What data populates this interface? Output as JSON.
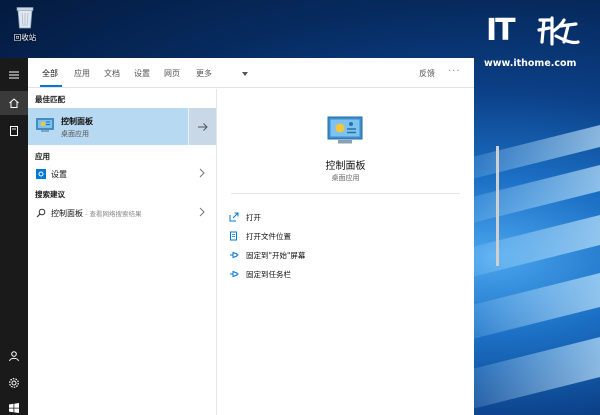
{
  "desktop": {
    "recycle_bin_label": "回收站",
    "watermark_logo_text": "IT之家",
    "site_url": "www.ithome.com"
  },
  "rail": {
    "icons": [
      "hamburger-icon",
      "home-icon",
      "notebook-icon",
      "user-icon",
      "gear-icon",
      "windows-icon"
    ]
  },
  "tabs": {
    "items": [
      {
        "label": "全部"
      },
      {
        "label": "应用"
      },
      {
        "label": "文档"
      },
      {
        "label": "设置"
      },
      {
        "label": "网页"
      },
      {
        "label": "更多"
      }
    ],
    "selected": "全部",
    "feedback": "反馈",
    "more_options": "···"
  },
  "results": {
    "best_match_header": "最佳匹配",
    "best_match": {
      "title": "控制面板",
      "subtitle": "桌面应用"
    },
    "apps_header": "应用",
    "apps": [
      {
        "label": "设置"
      }
    ],
    "suggestions_header": "搜索建议",
    "suggestions": [
      {
        "label": "控制面板",
        "hint": " - 查看网络搜索结果"
      }
    ]
  },
  "detail": {
    "title": "控制面板",
    "subtitle": "桌面应用",
    "actions": [
      {
        "label": "打开",
        "icon": "open-icon"
      },
      {
        "label": "打开文件位置",
        "icon": "file-location-icon"
      },
      {
        "label": "固定到\"开始\"屏幕",
        "icon": "pin-icon"
      },
      {
        "label": "固定到任务栏",
        "icon": "pin-icon"
      }
    ]
  },
  "colors": {
    "accent": "#0078d7",
    "best_match_bg": "#b8d9f2",
    "rail_bg": "#1a1a1a"
  }
}
